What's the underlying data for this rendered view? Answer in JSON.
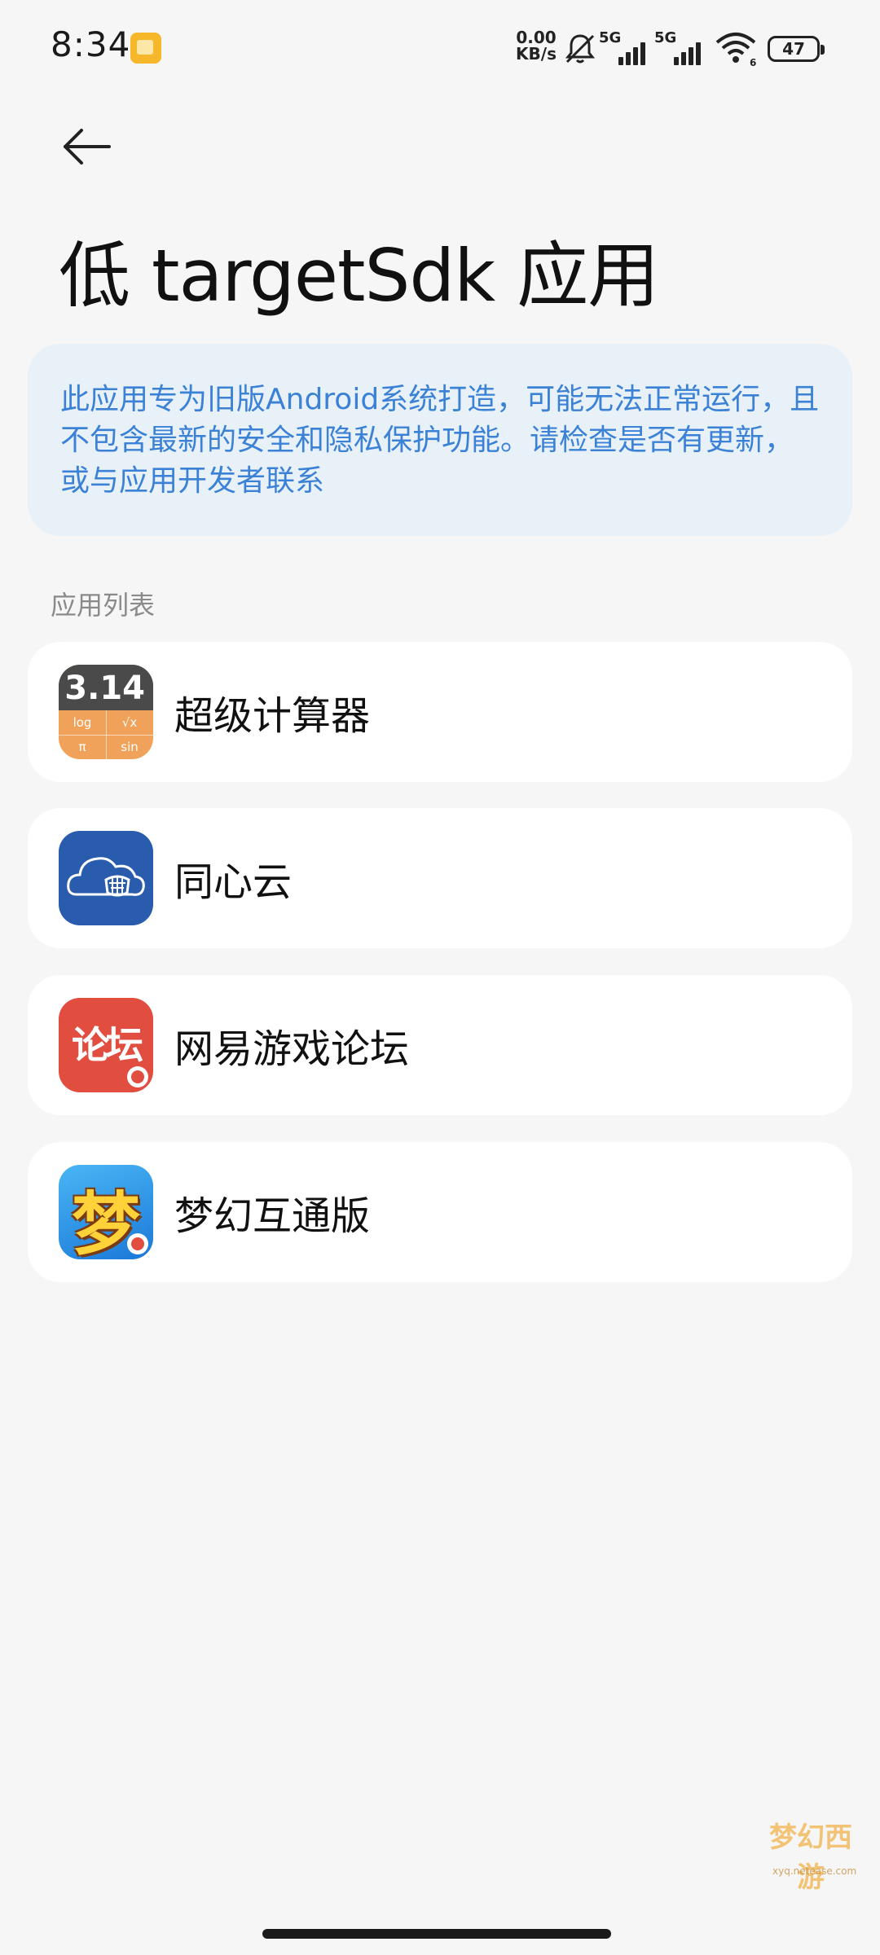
{
  "status_bar": {
    "time": "8:34",
    "net_speed_value": "0.00",
    "net_speed_unit": "KB/s",
    "sim1_label": "5G",
    "sim2_label": "5G",
    "wifi_badge": "6",
    "battery_level": "47"
  },
  "header": {
    "title": "低 targetSdk 应用"
  },
  "info": {
    "text": "此应用专为旧版Android系统打造，可能无法正常运行，且不包含最新的安全和隐私保护功能。请检查是否有更新，或与应用开发者联系"
  },
  "app_list": {
    "label": "应用列表",
    "items": [
      {
        "name": "超级计算器",
        "icon": "calculator-icon"
      },
      {
        "name": "同心云",
        "icon": "cloud-app-icon"
      },
      {
        "name": "网易游戏论坛",
        "icon": "forum-app-icon"
      },
      {
        "name": "梦幻互通版",
        "icon": "dream-game-icon"
      }
    ]
  },
  "calc_icon_text": {
    "display": "3.14",
    "k1": "log",
    "k2": "√x",
    "k3": "π",
    "k4": "sin"
  },
  "forum_icon_text": "论坛",
  "dream_icon_text": "梦",
  "watermark": {
    "text": "梦幻西游",
    "sub": "xyq.netease.com"
  },
  "colors": {
    "background": "#f6f6f6",
    "info_bg": "#e8f0f8",
    "info_text": "#3b82d6",
    "card_bg": "#ffffff"
  }
}
